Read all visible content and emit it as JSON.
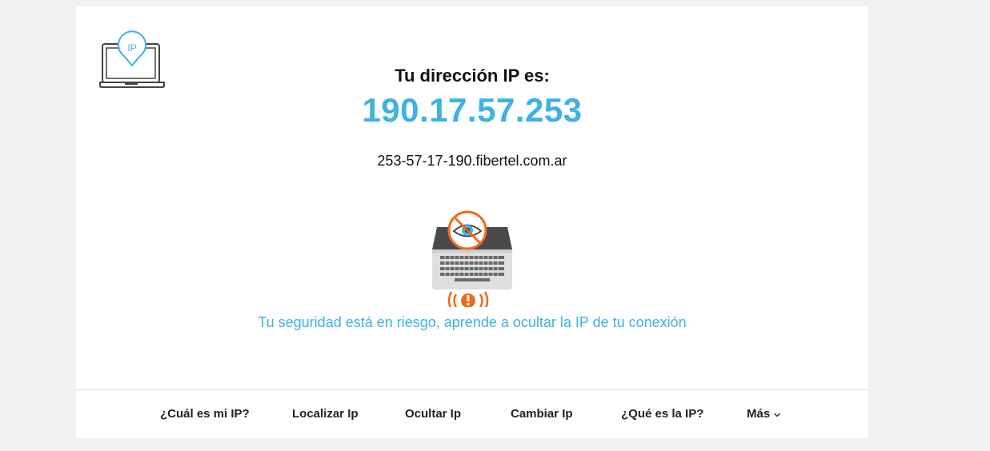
{
  "logo": {
    "icon": "ip-laptop-icon",
    "badge_text": "IP",
    "accent": "#3fb1e3"
  },
  "main": {
    "title": "Tu dirección IP es:",
    "ip_address": "190.17.57.253",
    "hostname": "253-57-17-190.fibertel.com.ar",
    "warning_icon": "laptop-eye-warning-icon",
    "risk_link": "Tu seguridad está en riesgo, aprende a ocultar la IP de tu conexión"
  },
  "nav": {
    "items": [
      {
        "label": "¿Cuál es mi IP?"
      },
      {
        "label": "Localizar Ip"
      },
      {
        "label": "Ocultar Ip"
      },
      {
        "label": "Cambiar Ip"
      },
      {
        "label": "¿Qué es la IP?"
      },
      {
        "label": "Más",
        "icon": "chevron-down-icon"
      }
    ]
  },
  "colors": {
    "accent_blue": "#3fb1e3",
    "warning_orange": "#f06a1d",
    "background": "#f1f1f1"
  }
}
